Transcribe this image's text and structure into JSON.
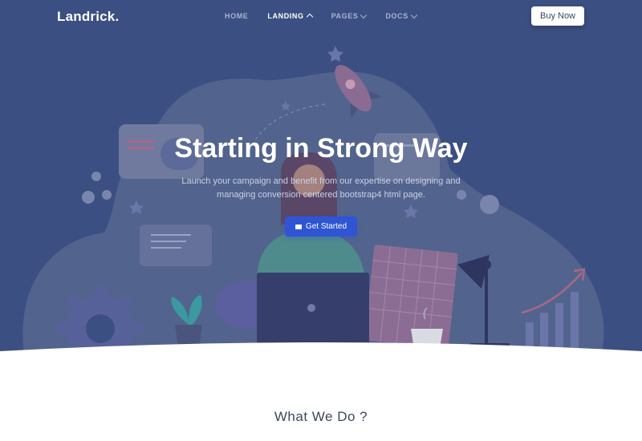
{
  "nav": {
    "logo": "Landrick.",
    "items": [
      {
        "label": "HOME",
        "active": false,
        "dropdown": false
      },
      {
        "label": "LANDING",
        "active": true,
        "dropdown": true
      },
      {
        "label": "PAGES",
        "active": false,
        "dropdown": true
      },
      {
        "label": "DOCS",
        "active": false,
        "dropdown": true
      }
    ],
    "buy_label": "Buy Now"
  },
  "hero": {
    "title": "Starting in Strong Way",
    "subtitle": "Launch your campaign and benefit from our expertise on designing and managing conversion centered bootstrap4 html page.",
    "cta_label": "Get Started",
    "cta_icon": "envelope-icon"
  },
  "section": {
    "title": "What We Do ?"
  },
  "colors": {
    "hero_bg": "#3c4f82",
    "primary": "#2f55d4"
  }
}
